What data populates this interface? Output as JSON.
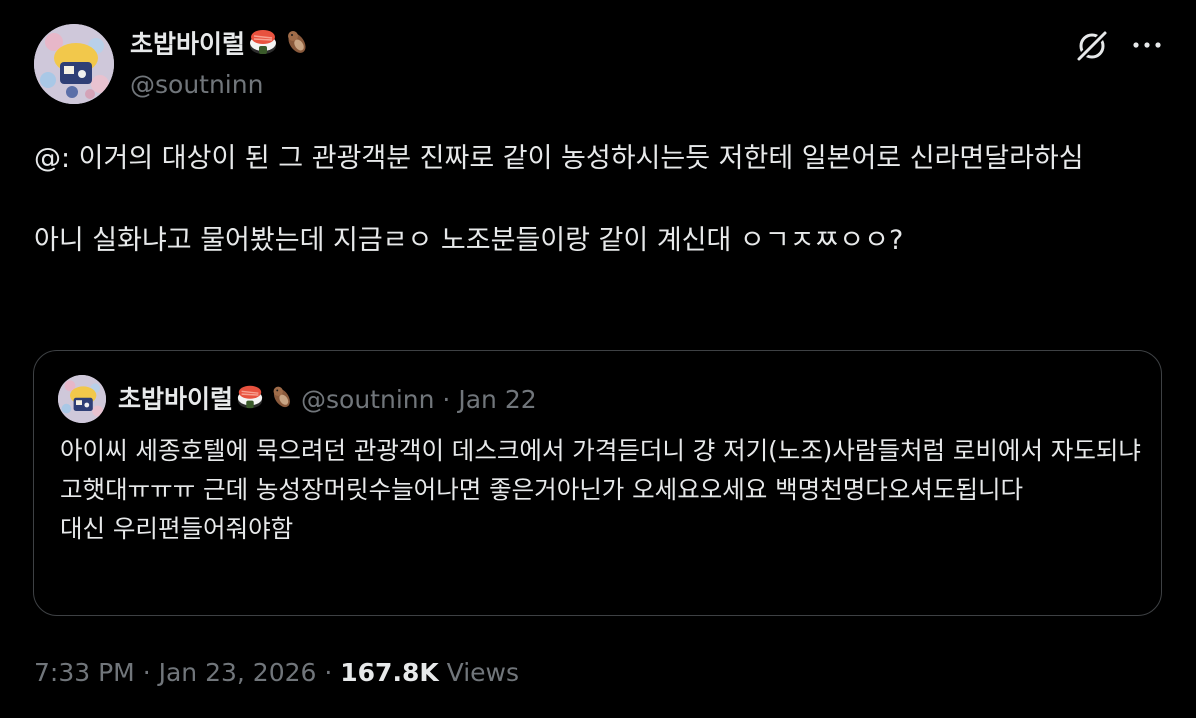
{
  "author": {
    "display_name": "초밥바이럴",
    "handle": "@soutninn",
    "name_emojis": [
      "sushi-emoji",
      "otter-emoji"
    ]
  },
  "tweet": {
    "text": "@: 이거의 대상이 된 그 관광객분 진짜로 같이 농성하시는듯 저한테 일본어로 신라면달라하심\n\n아니 실화냐고 물어봤는데 지금ㄹㅇ 노조분들이랑 같이 계신대 ㅇㄱㅈㅉㅇㅇ?"
  },
  "quote": {
    "display_name": "초밥바이럴",
    "handle": "@soutninn",
    "separator": "·",
    "date": "Jan 22",
    "text": "아이씨 세종호텔에 묵으려던 관광객이 데스크에서 가격듣더니 걍 저기(노조)사람들처럼 로비에서 자도되냐고햇대ㅠㅠㅠ 근데 농성장머릿수늘어나면 좋은거아닌가 오세요오세요 백명천명다오셔도됩니다\n대신 우리편들어줘야함"
  },
  "footer": {
    "time": "7:33 PM",
    "separator": "·",
    "date": "Jan 23, 2026",
    "views_count": "167.8K",
    "views_label": "Views"
  },
  "icons": {
    "grok": "grok-slash-icon",
    "more": "more-dots-icon"
  },
  "colors": {
    "background": "#000000",
    "text": "#e7e9ea",
    "secondary": "#71767b",
    "border": "#3e4144"
  }
}
